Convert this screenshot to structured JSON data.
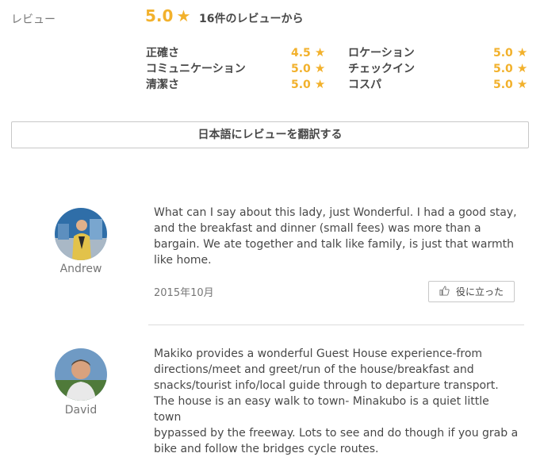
{
  "summary": {
    "label": "レビュー",
    "overall": "5.0",
    "star": "★",
    "count_text": "16件のレビューから"
  },
  "categories": [
    {
      "name": "正確さ",
      "score": "4.5"
    },
    {
      "name": "コミュニケーション",
      "score": "5.0"
    },
    {
      "name": "清潔さ",
      "score": "5.0"
    },
    {
      "name": "ロケーション",
      "score": "5.0"
    },
    {
      "name": "チェックイン",
      "score": "5.0"
    },
    {
      "name": "コスパ",
      "score": "5.0"
    }
  ],
  "translate_button": "日本語にレビューを翻訳する",
  "reviews": [
    {
      "name": "Andrew",
      "lines": [
        "What can I say about this lady, just Wonderful. I had a good stay,",
        "and the breakfast and dinner (small fees) was more than a",
        "bargain. We ate together and talk like family, is just that warmth",
        "like home."
      ],
      "date": "2015年10月",
      "helpful": "役に立った"
    },
    {
      "name": "David",
      "lines": [
        "Makiko provides a wonderful Guest House experience-from",
        "directions/meet and greet/run of the house/breakfast and",
        "snacks/tourist info/local guide through to departure transport.",
        "The house is an easy walk to town- Minakubo is a quiet little town",
        "bypassed by the freeway. Lots to see and do though if you grab a",
        "bike and follow the bridges cycle routes."
      ]
    }
  ],
  "colors": {
    "accent": "#f2b12c",
    "text": "#484848",
    "muted": "#767676",
    "border": "#c8c8c8"
  }
}
